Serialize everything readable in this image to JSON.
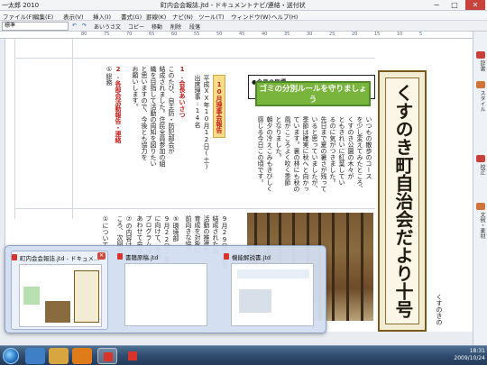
{
  "window": {
    "app_name": "一太郎 2010",
    "doc_title": "町内会会報誌.jtd - ドキュメントナビ/連絡・送付状",
    "min": "−",
    "max": "□",
    "close": "✕"
  },
  "menu": [
    "ファイル(F)",
    "編集(E)",
    "表示(V)",
    "挿入(I)",
    "書式(G)",
    "罫線(K)",
    "ナビ(N)",
    "ツール(T)",
    "ウィンドウ(W)",
    "ヘルプ(H)"
  ],
  "toolbar": {
    "style_value": "標準",
    "buttons": [
      "あいうさ文",
      "コピー",
      "移動",
      "削除",
      "段落"
    ]
  },
  "ruler": [
    "80",
    "75",
    "70",
    "65",
    "60",
    "55",
    "50",
    "45",
    "40",
    "35",
    "30",
    "25",
    "20",
    "15",
    "10",
    "5"
  ],
  "article": {
    "meeting_badge": "10月理事会報告",
    "date": "平成XX年10月12日(土)",
    "attendees": "出席理事:14名",
    "section1_head": "1.会長あいさつ",
    "section1_lines": [
      "このたび、自主防・防犯部会が",
      "結成されました。住民全員参加の組",
      "織を目指して活動の周知を図りたい",
      "と思いますので、今後とも協力を",
      "お願いします。"
    ],
    "section2_head": "2.各部会活動報告・連絡",
    "section2_sub": "①総務",
    "lower_cols": [
      "⑦の内容は",
      "ころ、次回の",
      "9月22日・並木",
      "に向けて、準備",
      "プログラムは",
      "あわせて会報",
      "⑤環境部",
      "①について"
    ]
  },
  "goal_panel": {
    "heading": "●今月の目標",
    "headline": "ゴミの分別ルールを守りましょう"
  },
  "essay_lines": [
    "いつもの散歩のコース",
    "を少し変えてみたところ、",
    "くすのき公園の木々が",
    "ともきれいに紅葉してい",
    "るのに気がつきました。",
    "先日まで夏の暑さが残って",
    "いると思っていましたが、",
    "季節は確実に秋へと向かっ",
    "ています。裏の林にも秋の",
    "風がこころよく吹く季節",
    "となりました。",
    "朝夕の冷えこみもきびしく",
    "感じる今日この頃です。"
  ],
  "lower_right_col": [
    "9月29日・自治",
    "結成された会",
    "活動の推進を",
    "育成を対象に",
    "前向きな協力"
  ],
  "masthead": {
    "title": "くすのき町自治会だより十号"
  },
  "side_label": "くすのきの",
  "right_pane_tabs": [
    "辞書",
    "スタイル",
    "校正",
    "文例・素材"
  ],
  "thumbs": [
    {
      "label": "町内会会報誌.jtd - ドキュメ...",
      "close": "✕"
    },
    {
      "label": "書籍原稿.jtd"
    },
    {
      "label": "機能解説書.jtd"
    }
  ],
  "tray": {
    "time": "18:31",
    "date": "2009/10/24"
  },
  "colors": {
    "goal_green": "#79b53c",
    "badge_yellow": "#f7dd8a",
    "masthead_frame": "#7a5a1a",
    "heading_red": "#c2231e"
  }
}
